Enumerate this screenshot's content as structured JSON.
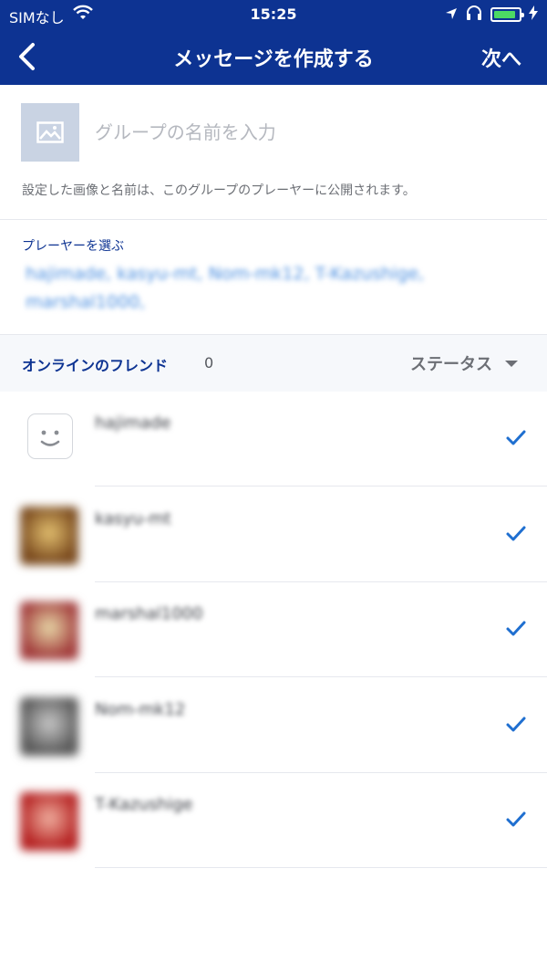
{
  "statusbar": {
    "carrier": "SIMなし",
    "time": "15:25",
    "battery_level": 0.9
  },
  "navbar": {
    "title": "メッセージを作成する",
    "next": "次へ"
  },
  "group": {
    "name_placeholder": "グループの名前を入力",
    "hint": "設定した画像と名前は、このグループのプレーヤーに公開されます。"
  },
  "players": {
    "label": "プレーヤーを選ぶ",
    "selected": "hajimade, kasyu-mt, Nom-mk12, T-Kazushige, marshal1000,"
  },
  "friends": {
    "title": "オンラインのフレンド",
    "count": "0",
    "status_label": "ステータス",
    "items": [
      {
        "name": "hajimade",
        "avatar": "default-face-icon",
        "checked": true
      },
      {
        "name": "kasyu-mt",
        "avatar": "photo",
        "colors": [
          "#7a4a1e",
          "#e3c070"
        ],
        "checked": true
      },
      {
        "name": "marshal1000",
        "avatar": "photo",
        "colors": [
          "#a23c3c",
          "#e8d9a8"
        ],
        "checked": true
      },
      {
        "name": "Nom-mk12",
        "avatar": "photo",
        "colors": [
          "#5a5a5a",
          "#c8c8c8"
        ],
        "checked": true
      },
      {
        "name": "T-Kazushige",
        "avatar": "photo",
        "colors": [
          "#b52222",
          "#f0b0a0"
        ],
        "checked": true
      }
    ]
  },
  "colors": {
    "navbar": "#0d3392",
    "accent": "#1f6fd0",
    "players_text": "#4a8ee0"
  }
}
